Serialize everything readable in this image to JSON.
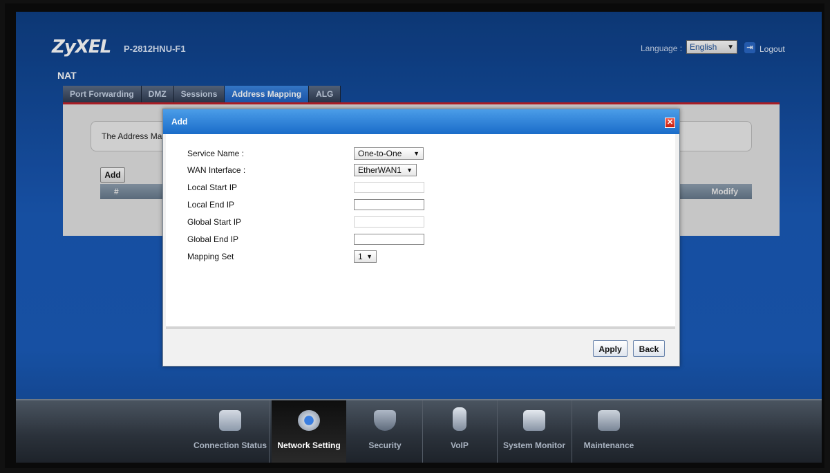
{
  "header": {
    "logo": "ZyXEL",
    "model": "P-2812HNU-F1",
    "language_label": "Language :",
    "language_value": "English",
    "logout_label": "Logout"
  },
  "page": {
    "section_title": "NAT",
    "tabs": [
      {
        "label": "Port Forwarding",
        "active": false
      },
      {
        "label": "DMZ",
        "active": false
      },
      {
        "label": "Sessions",
        "active": false
      },
      {
        "label": "Address Mapping",
        "active": true
      },
      {
        "label": "ALG",
        "active": false
      }
    ],
    "info_text": "The Address Ma",
    "add_label": "Add",
    "table_headers": [
      "#",
      "Modify"
    ]
  },
  "dialog": {
    "title": "Add",
    "close_symbol": "✕",
    "fields": [
      {
        "label": "Service Name :",
        "type": "select",
        "value": "One-to-One"
      },
      {
        "label": "WAN Interface :",
        "type": "select",
        "value": "EtherWAN1"
      },
      {
        "label": "Local Start IP",
        "type": "text",
        "value": "",
        "disabled": true
      },
      {
        "label": "Local End IP",
        "type": "text",
        "value": "",
        "disabled": false
      },
      {
        "label": "Global Start IP",
        "type": "text",
        "value": "",
        "disabled": true
      },
      {
        "label": "Global End IP",
        "type": "text",
        "value": "",
        "disabled": false
      },
      {
        "label": "Mapping Set",
        "type": "select",
        "value": "1"
      }
    ],
    "apply_label": "Apply",
    "back_label": "Back"
  },
  "bottom_nav": [
    {
      "label": "Connection Status",
      "icon": "connection-status-icon",
      "active": false
    },
    {
      "label": "Network Setting",
      "icon": "network-setting-icon",
      "active": true
    },
    {
      "label": "Security",
      "icon": "security-icon",
      "active": false
    },
    {
      "label": "VoIP",
      "icon": "voip-phone-icon",
      "active": false
    },
    {
      "label": "System Monitor",
      "icon": "system-monitor-icon",
      "active": false
    },
    {
      "label": "Maintenance",
      "icon": "maintenance-icon",
      "active": false
    }
  ],
  "colors": {
    "accent_red": "#c0222b",
    "dialog_header": "#1a6cc9",
    "app_blue": "#1a5ab8"
  }
}
